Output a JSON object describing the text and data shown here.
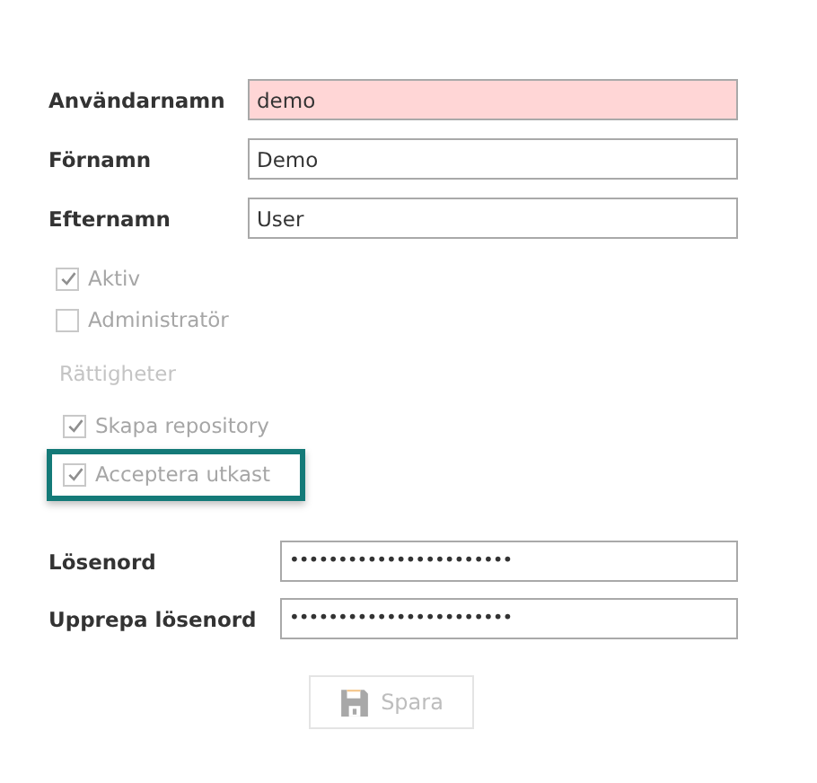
{
  "user_fields": [
    {
      "label": "Användarnamn",
      "value": "demo",
      "invalid": true
    },
    {
      "label": "Förnamn",
      "value": "Demo",
      "invalid": false
    },
    {
      "label": "Efternamn",
      "value": "User",
      "invalid": false
    }
  ],
  "flags": [
    {
      "label": "Aktiv",
      "checked": true,
      "highlighted": false
    },
    {
      "label": "Administratör",
      "checked": false,
      "highlighted": false
    }
  ],
  "permissions": {
    "heading": "Rättigheter",
    "items": [
      {
        "label": "Skapa repository",
        "checked": true,
        "highlighted": false
      },
      {
        "label": "Acceptera utkast",
        "checked": true,
        "highlighted": true
      }
    ]
  },
  "password_fields": [
    {
      "label": "Lösenord",
      "value": "•••••••••••••••••••••••"
    },
    {
      "label": "Upprepa lösenord",
      "value": "•••••••••••••••••••••••"
    }
  ],
  "save_button": {
    "label": "Spara",
    "disabled": true
  }
}
